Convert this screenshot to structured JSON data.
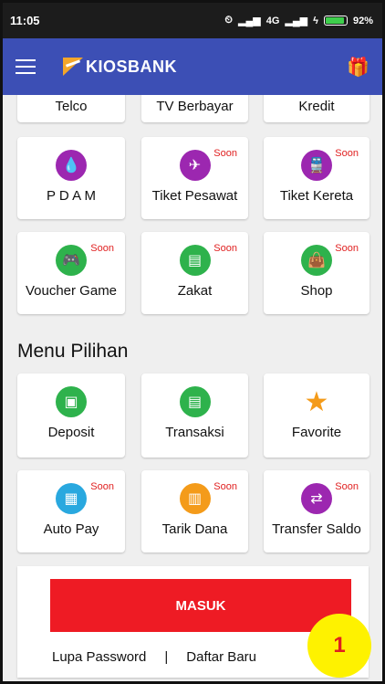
{
  "status": {
    "time": "11:05",
    "network": "4G",
    "battery": "92%"
  },
  "app": {
    "logo": "KIOSBANK"
  },
  "partial_row": [
    "Telco",
    "TV Berbayar",
    "Kredit"
  ],
  "services": [
    {
      "label": "P D A M",
      "soon": "",
      "icon": "water-icon",
      "color": "#9c27b0"
    },
    {
      "label": "Tiket Pesawat",
      "soon": "Soon",
      "icon": "plane-icon",
      "color": "#9c27b0"
    },
    {
      "label": "Tiket Kereta",
      "soon": "Soon",
      "icon": "train-icon",
      "color": "#9c27b0"
    },
    {
      "label": "Voucher Game",
      "soon": "Soon",
      "icon": "gamepad-icon",
      "color": "#2eb24c"
    },
    {
      "label": "Zakat",
      "soon": "Soon",
      "icon": "receipt-icon",
      "color": "#2eb24c"
    },
    {
      "label": "Shop",
      "soon": "Soon",
      "icon": "bag-icon",
      "color": "#2eb24c"
    }
  ],
  "section_title": "Menu Pilihan",
  "menu": [
    {
      "label": "Deposit",
      "soon": "",
      "icon": "wallet-icon",
      "color": "#2eb24c"
    },
    {
      "label": "Transaksi",
      "soon": "",
      "icon": "receipt-icon",
      "color": "#2eb24c"
    },
    {
      "label": "Favorite",
      "soon": "",
      "icon": "star-icon",
      "color": "#f49b1a"
    },
    {
      "label": "Auto Pay",
      "soon": "Soon",
      "icon": "autopay-icon",
      "color": "#29a8df"
    },
    {
      "label": "Tarik Dana",
      "soon": "Soon",
      "icon": "withdraw-icon",
      "color": "#f49b1a"
    },
    {
      "label": "Transfer Saldo",
      "soon": "Soon",
      "icon": "transfer-icon",
      "color": "#9c27b0"
    }
  ],
  "login": {
    "button": "MASUK",
    "forgot": "Lupa Password",
    "separator": "|",
    "register": "Daftar Baru"
  },
  "badge": "1"
}
